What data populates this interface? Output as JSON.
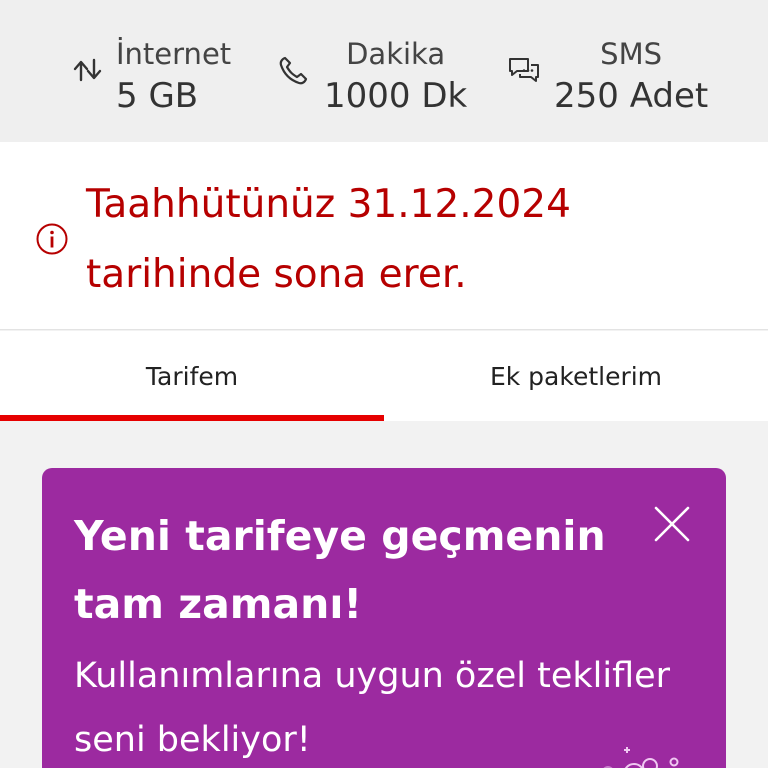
{
  "usage": {
    "internet": {
      "label": "İnternet",
      "value": "5 GB",
      "icon": "data-transfer-icon"
    },
    "minutes": {
      "label": "Dakika",
      "value": "1000 Dk",
      "icon": "phone-icon"
    },
    "sms": {
      "label": "SMS",
      "value": "250 Adet",
      "icon": "chat-icon"
    }
  },
  "notice": {
    "text": "Taahhütünüz 31.12.2024 tarihinde sona erer.",
    "icon": "info-icon",
    "color": "#b60000"
  },
  "tabs": [
    {
      "label": "Tarifem",
      "active": true
    },
    {
      "label": "Ek paketlerim",
      "active": false
    }
  ],
  "promo": {
    "title": "Yeni tarifeye geçmenin tam zamanı!",
    "subtitle": "Kullanımlarına uygun özel teklifler seni bekliyor!",
    "close_icon": "close-icon",
    "background": "#9c2aa0"
  },
  "colors": {
    "accent": "#e60000",
    "promo": "#9c2aa0"
  }
}
